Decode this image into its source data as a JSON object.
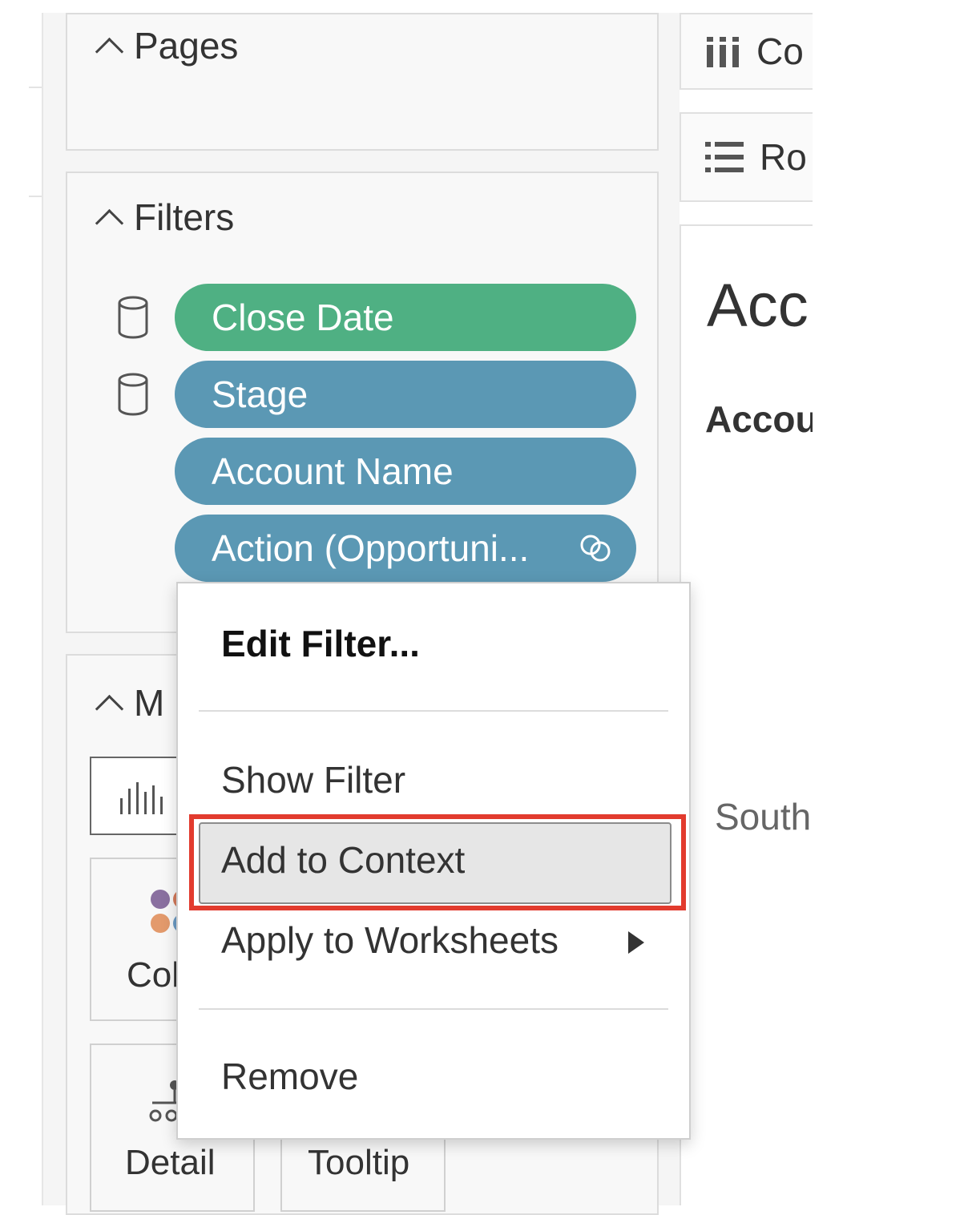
{
  "pages_card": {
    "title": "Pages"
  },
  "filters_card": {
    "title": "Filters",
    "pills": [
      {
        "label": "Close Date",
        "color": "#4fb083",
        "has_db_icon": true
      },
      {
        "label": "Stage",
        "color": "#5b98b4",
        "has_db_icon": true
      },
      {
        "label": "Account Name",
        "color": "#5b98b4",
        "has_db_icon": false
      },
      {
        "label": "Action (Opportuni...",
        "color": "#5b98b4",
        "has_db_icon": false,
        "icon": "linked-rings-icon"
      }
    ]
  },
  "marks_card": {
    "title": "M",
    "mark_type_icon": "bar-chart-icon",
    "tiles": [
      {
        "label": "Col",
        "icon": "color-dots-icon"
      },
      {
        "label": "Detail",
        "icon": "detail-icon"
      },
      {
        "label": "Tooltip",
        "icon": ""
      }
    ]
  },
  "right_pane": {
    "columns_label": "Co",
    "rows_label": "Ro",
    "sheet_title": "Acc",
    "header_text": "Accou",
    "cell_text": "South"
  },
  "context_menu": {
    "items": [
      {
        "label": "Edit Filter...",
        "bold": true
      },
      {
        "label": "Show Filter"
      },
      {
        "label": "Add to Context",
        "highlighted": true
      },
      {
        "label": "Apply to Worksheets",
        "has_submenu": true
      },
      {
        "label": "Remove"
      }
    ]
  },
  "colors": {
    "highlight_annotation": "#e23b2e",
    "pill_green": "#4fb083",
    "pill_blue": "#5b98b4"
  }
}
